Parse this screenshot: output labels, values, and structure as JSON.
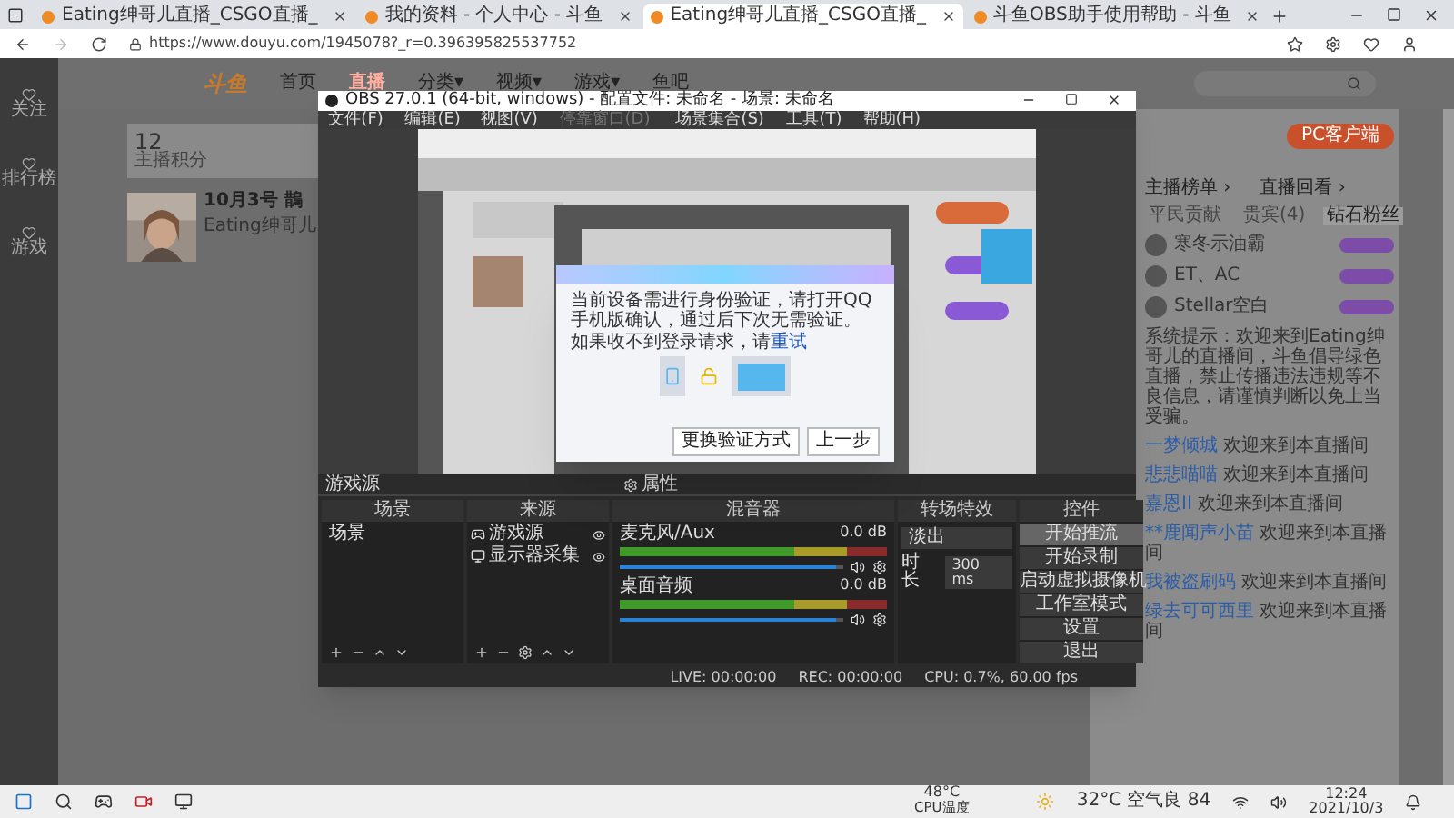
{
  "browser": {
    "tabs": [
      {
        "title": "Eating绅哥儿直播_CSGO直播_",
        "selected": false
      },
      {
        "title": "我的资料 - 个人中心 - 斗鱼",
        "selected": false
      },
      {
        "title": "Eating绅哥儿直播_CSGO直播_",
        "selected": true
      },
      {
        "title": "斗鱼OBS助手使用帮助 - 斗鱼",
        "selected": false
      }
    ],
    "url": "https://www.douyu.com/1945078?_r=0.396395825537752"
  },
  "site": {
    "logo": "斗鱼",
    "nav": [
      {
        "label": "首页",
        "selected": false
      },
      {
        "label": "直播",
        "selected": true
      },
      {
        "label": "分类▾",
        "selected": false
      },
      {
        "label": "视频▾",
        "selected": false
      },
      {
        "label": "游戏▾",
        "selected": false
      },
      {
        "label": "鱼吧",
        "selected": false
      }
    ],
    "sidebar": [
      "关注",
      "排行榜",
      "游戏"
    ],
    "stats": [
      {
        "value": "12",
        "label": "主播积分"
      }
    ],
    "room": {
      "title": "10月3号 鵲",
      "anchor": "Eating绅哥儿"
    }
  },
  "obs": {
    "title": "OBS 27.0.1 (64-bit, windows) - 配置文件: 未命名 - 场景: 未命名",
    "menu": [
      {
        "label": "文件(F)",
        "disabled": false
      },
      {
        "label": "编辑(E)",
        "disabled": false
      },
      {
        "label": "视图(V)",
        "disabled": false
      },
      {
        "label": "停靠窗口(D)",
        "disabled": true
      },
      {
        "label": "场景集合(S)",
        "disabled": false
      },
      {
        "label": "工具(T)",
        "disabled": false
      },
      {
        "label": "帮助(H)",
        "disabled": false
      }
    ],
    "source_bar": {
      "name": "游戏源",
      "button": "属性"
    },
    "docks": {
      "scenes": "场景",
      "sources": "来源",
      "mixer": "混音器",
      "transitions": "转场特效",
      "controls": "控件"
    },
    "scenes": [
      "场景"
    ],
    "sources": [
      {
        "name": "游戏源",
        "kind": "game"
      },
      {
        "name": "显示器采集",
        "kind": "monitor"
      }
    ],
    "channels": [
      {
        "name": "麦克风/Aux",
        "reading": "0.0 dB",
        "level": 0.97
      },
      {
        "name": "桌面音频",
        "reading": "0.0 dB",
        "level": 0.97
      }
    ],
    "transition": {
      "value": "淡出",
      "duration_label": "时长",
      "duration": "300 ms"
    },
    "controls": [
      {
        "label": "开始推流",
        "selected": true
      },
      {
        "label": "开始录制",
        "selected": false
      },
      {
        "label": "启动虚拟摄像机",
        "selected": false
      },
      {
        "label": "工作室模式",
        "selected": false
      },
      {
        "label": "设置",
        "selected": false
      },
      {
        "label": "退出",
        "selected": false
      }
    ],
    "status": {
      "live": "LIVE: 00:00:00",
      "rec": "REC: 00:00:00",
      "cpu": "CPU: 0.7%, 60.00 fps"
    }
  },
  "dialog": {
    "text": "当前设备需进行身份验证，请打开QQ手机版确认，通过后下次无需验证。",
    "hint": "如果收不到登录请求，请",
    "link": "重试",
    "buttons": [
      "更换验证方式",
      "上一步"
    ]
  },
  "chat": {
    "client_button": "PC客户端",
    "links": [
      "主播榜单 ›",
      "直播回看 ›"
    ],
    "tabs": [
      {
        "label": "平民贡献",
        "selected": false
      },
      {
        "label": "贵宾(4)",
        "selected": false
      },
      {
        "label": "钻石粉丝",
        "selected": true
      }
    ],
    "fans": [
      "寒冬示油霸",
      "ET、AC",
      "Stellar空白"
    ],
    "notice": "系统提示：欢迎来到Eating绅哥儿的直播间，斗鱼倡导绿色直播，禁止传播违法违规等不良信息，请谨慎判断以免上当受骗。",
    "messages": [
      {
        "user": "一梦倾城",
        "text": "欢迎来到本直播间"
      },
      {
        "user": "悲悲喵喵",
        "text": "欢迎来到本直播间"
      },
      {
        "user": "嘉恩II",
        "text": "欢迎来到本直播间"
      },
      {
        "user": "**鹿闻声小苗",
        "text": "欢迎来到本直播间"
      },
      {
        "user": "我被盗刷码",
        "text": "欢迎来到本直播间"
      },
      {
        "user": "绿去可可西里",
        "text": "欢迎来到本直播间"
      }
    ]
  },
  "taskbar": {
    "cpu_temp": "48°C",
    "cpu_label": "CPU温度",
    "weather": "32°C 空气良 84",
    "time": "12:24",
    "date": "2021/10/3"
  }
}
